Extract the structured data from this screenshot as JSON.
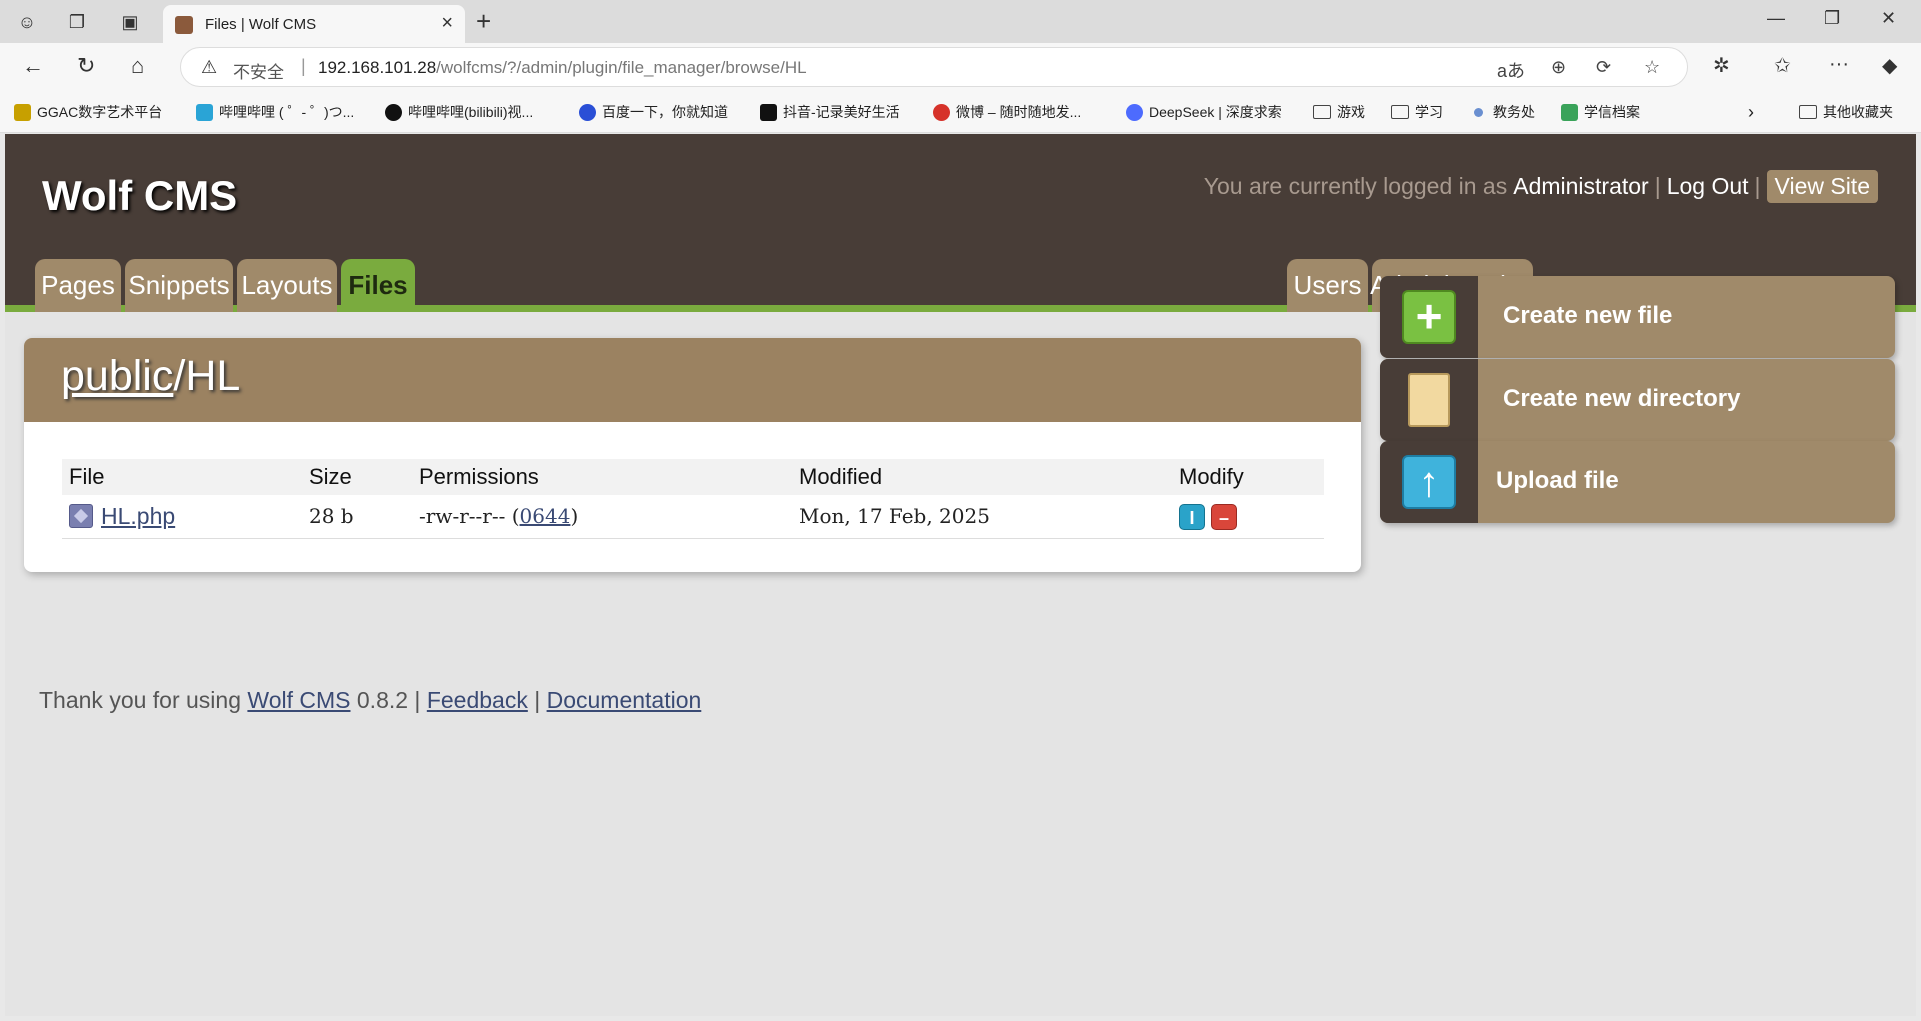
{
  "browser": {
    "tab_title": "Files | Wolf CMS",
    "security_label": "不安全",
    "url_host": "192.168.101.28",
    "url_path": "/wolfcms/?/admin/plugin/file_manager/browse/HL"
  },
  "bookmarks": [
    {
      "label": "GGAC数字艺术平台",
      "color": "#c7a000"
    },
    {
      "label": "哔哩哔哩 ( ゜- ゜)つ...",
      "color": "#2aa4d6"
    },
    {
      "label": "哔哩哔哩(bilibili)视...",
      "color": "#111111"
    },
    {
      "label": "百度一下，你就知道",
      "color": "#2a4fd6"
    },
    {
      "label": "抖音-记录美好生活",
      "color": "#111111"
    },
    {
      "label": "微博 – 随时随地发...",
      "color": "#d6322a"
    },
    {
      "label": "DeepSeek | 深度求索",
      "color": "#4d6bfe"
    },
    {
      "label": "游戏",
      "folder": true
    },
    {
      "label": "学习",
      "folder": true
    },
    {
      "label": "教务处",
      "color": "#6a8fd0"
    },
    {
      "label": "学信档案",
      "color": "#3aa35a"
    }
  ],
  "other_bookmarks": "其他收藏夹",
  "cms": {
    "logo": "Wolf CMS",
    "login_prefix": "You are currently logged in as",
    "user": "Administrator",
    "sep1": "|",
    "logout": "Log Out",
    "sep2": "|",
    "view_site": "View Site",
    "nav_left": [
      "Pages",
      "Snippets",
      "Layouts",
      "Files"
    ],
    "nav_right": [
      "Users",
      "Administration"
    ],
    "active_tab": "Files"
  },
  "browser_panel": {
    "crumb_root": "public",
    "crumb_sep": "/",
    "crumb_current": "HL",
    "columns": [
      "File",
      "Size",
      "Permissions",
      "Modified",
      "Modify"
    ],
    "rows": [
      {
        "file": "HL.php",
        "size": "28 b",
        "perms": "-rw-r--r--",
        "perm_open": " (",
        "octal": "0644",
        "perm_close": ")",
        "modified": "Mon, 17 Feb, 2025"
      }
    ]
  },
  "actions": {
    "create_file": "Create new file",
    "create_dir": "Create new directory",
    "upload": "Upload file"
  },
  "footer": {
    "prefix": "Thank you for using",
    "cms_link": "Wolf CMS",
    "version": " 0.8.2 | ",
    "feedback": "Feedback",
    "sep": " | ",
    "docs": "Documentation"
  }
}
